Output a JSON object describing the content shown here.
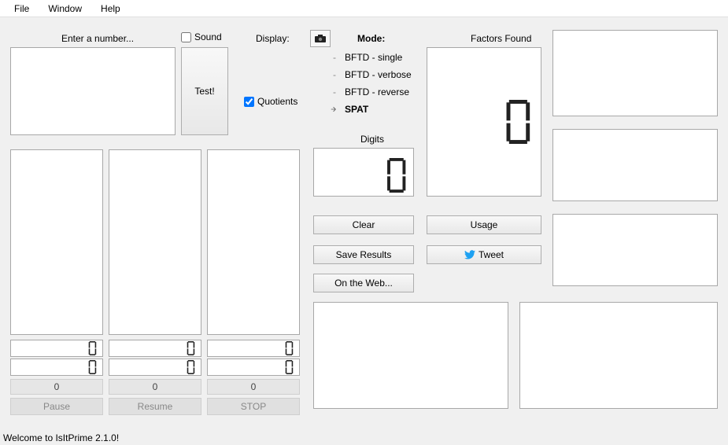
{
  "menu": {
    "file": "File",
    "window": "Window",
    "help": "Help"
  },
  "labels": {
    "enter_number": "Enter a number...",
    "sound": "Sound",
    "display": "Display:",
    "quotients": "Quotients",
    "mode": "Mode:",
    "digits": "Digits",
    "factors_found": "Factors Found"
  },
  "buttons": {
    "test": "Test!",
    "clear": "Clear",
    "usage": "Usage",
    "save_results": "Save Results",
    "tweet": "Tweet",
    "on_the_web": "On the Web...",
    "pause": "Pause",
    "resume": "Resume",
    "stop": "STOP"
  },
  "modes": {
    "m1": "BFTD - single",
    "m2": "BFTD - verbose",
    "m3": "BFTD - reverse",
    "m4": "SPAT"
  },
  "checkboxes": {
    "sound": false,
    "quotients": true
  },
  "displays": {
    "digits": "0",
    "factors_found": "0",
    "col1_a": "0",
    "col1_b": "0",
    "col2_a": "0",
    "col2_b": "0",
    "col3_a": "0",
    "col3_b": "0",
    "count1": "0",
    "count2": "0",
    "count3": "0"
  },
  "status": "Welcome to IsItPrime 2.1.0!"
}
